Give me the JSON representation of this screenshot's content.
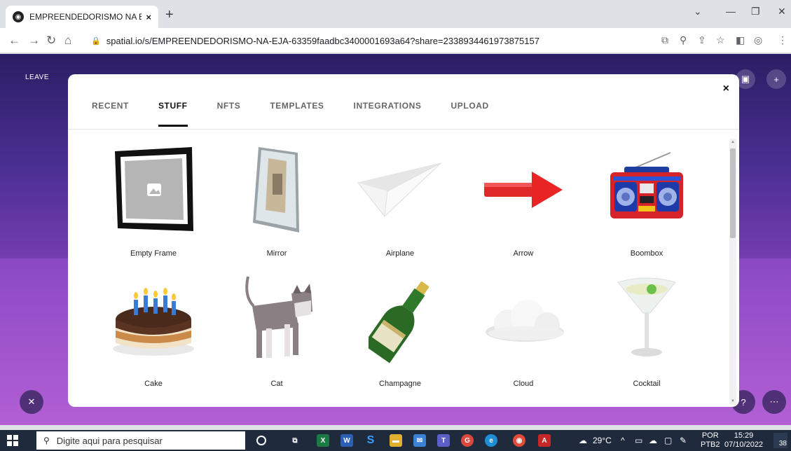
{
  "browser": {
    "tab_title": "EMPREENDEDORISMO NA EJA | S",
    "tab_close": "×",
    "new_tab": "+",
    "url": "spatial.io/s/EMPREENDEDORISMO-NA-EJA-63359faadbc3400001693a64?share=2338934461973875157"
  },
  "scene": {
    "leave_label": "LEAVE"
  },
  "modal": {
    "close": "×",
    "tabs": [
      {
        "label": "RECENT"
      },
      {
        "label": "STUFF"
      },
      {
        "label": "NFTS"
      },
      {
        "label": "TEMPLATES"
      },
      {
        "label": "INTEGRATIONS"
      },
      {
        "label": "UPLOAD"
      }
    ],
    "active_tab": "STUFF",
    "items": [
      {
        "label": "Empty Frame",
        "icon": "frame-icon"
      },
      {
        "label": "Mirror",
        "icon": "mirror-icon"
      },
      {
        "label": "Airplane",
        "icon": "paper-airplane-icon"
      },
      {
        "label": "Arrow",
        "icon": "arrow-icon"
      },
      {
        "label": "Boombox",
        "icon": "boombox-icon"
      },
      {
        "label": "Cake",
        "icon": "cake-icon"
      },
      {
        "label": "Cat",
        "icon": "cat-icon"
      },
      {
        "label": "Champagne",
        "icon": "champagne-icon"
      },
      {
        "label": "Cloud",
        "icon": "cloud-icon"
      },
      {
        "label": "Cocktail",
        "icon": "cocktail-icon"
      }
    ]
  },
  "taskbar": {
    "search_placeholder": "Digite aqui para pesquisar",
    "weather": "29°C",
    "lang_line1": "POR",
    "lang_line2": "PTB2",
    "time": "15:29",
    "date": "07/10/2022",
    "notifications": "38"
  }
}
